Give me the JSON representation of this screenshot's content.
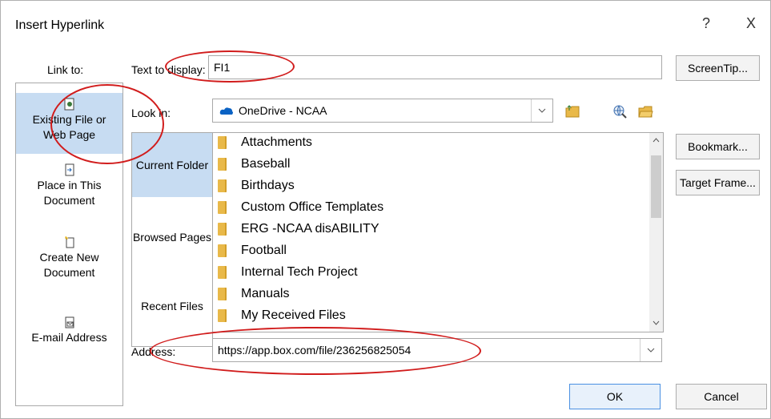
{
  "dialog": {
    "title": "Insert Hyperlink",
    "help": "?",
    "close": "X"
  },
  "link_to": {
    "label": "Link to:",
    "items": [
      {
        "label_lines": [
          "Existing File or",
          "Web Page"
        ],
        "selected": true,
        "icon": "existing-file-icon"
      },
      {
        "label_lines": [
          "Place in This",
          "Document"
        ],
        "selected": false,
        "icon": "place-in-document-icon"
      },
      {
        "label_lines": [
          "Create New",
          "Document"
        ],
        "selected": false,
        "icon": "create-new-document-icon"
      },
      {
        "label_lines": [
          "E-mail Address"
        ],
        "selected": false,
        "icon": "email-address-icon"
      }
    ]
  },
  "text_to_display": {
    "label": "Text to display:",
    "value": "FI1"
  },
  "screentip_label": "ScreenTip...",
  "look_in": {
    "label": "Look in:",
    "value": "OneDrive - NCAA",
    "icon": "onedrive-icon"
  },
  "nav_tabs": [
    {
      "label": "Current Folder",
      "selected": true
    },
    {
      "label": "Browsed Pages",
      "selected": false
    },
    {
      "label": "Recent Files",
      "selected": false
    }
  ],
  "files": [
    "Attachments",
    "Baseball",
    "Birthdays",
    "Custom Office Templates",
    "ERG -NCAA disABILITY",
    "Football",
    "Internal Tech Project",
    "Manuals",
    "My Received Files"
  ],
  "right_buttons": {
    "bookmark": "Bookmark...",
    "target_frame": "Target Frame..."
  },
  "address": {
    "label": "Address:",
    "value": "https://app.box.com/file/236256825054"
  },
  "buttons": {
    "ok": "OK",
    "cancel": "Cancel"
  },
  "colors": {
    "selection": "#c7dcf2",
    "annotation": "#d11c1c",
    "folder": "#e9b949"
  }
}
